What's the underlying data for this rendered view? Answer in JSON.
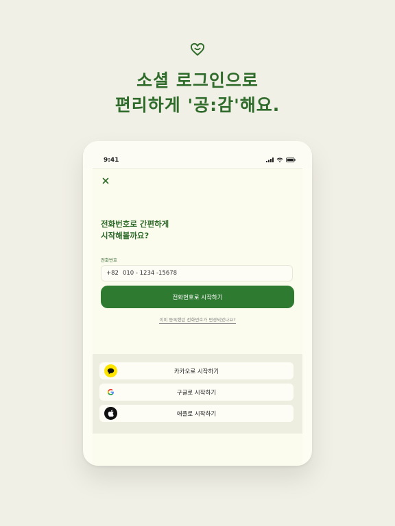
{
  "headline": {
    "line1": "소셜 로그인으로",
    "line2": "편리하게 '공:감'해요."
  },
  "status_bar": {
    "time": "9:41"
  },
  "screen": {
    "title_line1": "전화번호로 간편하게",
    "title_line2": "시작해볼까요?",
    "phone_label": "전화번호",
    "phone_country_code": "+82",
    "phone_value": "010 - 1234 -15678",
    "primary_button": "전화번호로 시작하기",
    "changed_number_link": "이미 등록했던 전화번호가 변경되었나요?"
  },
  "social": {
    "kakao": "카카오로 시작하기",
    "google": "구글로 시작하기",
    "apple": "애플로 시작하기"
  },
  "colors": {
    "brand_green": "#2f7a31",
    "headline_green": "#2f6b2a",
    "kakao_yellow": "#fee500",
    "background": "#f1f0e6"
  }
}
